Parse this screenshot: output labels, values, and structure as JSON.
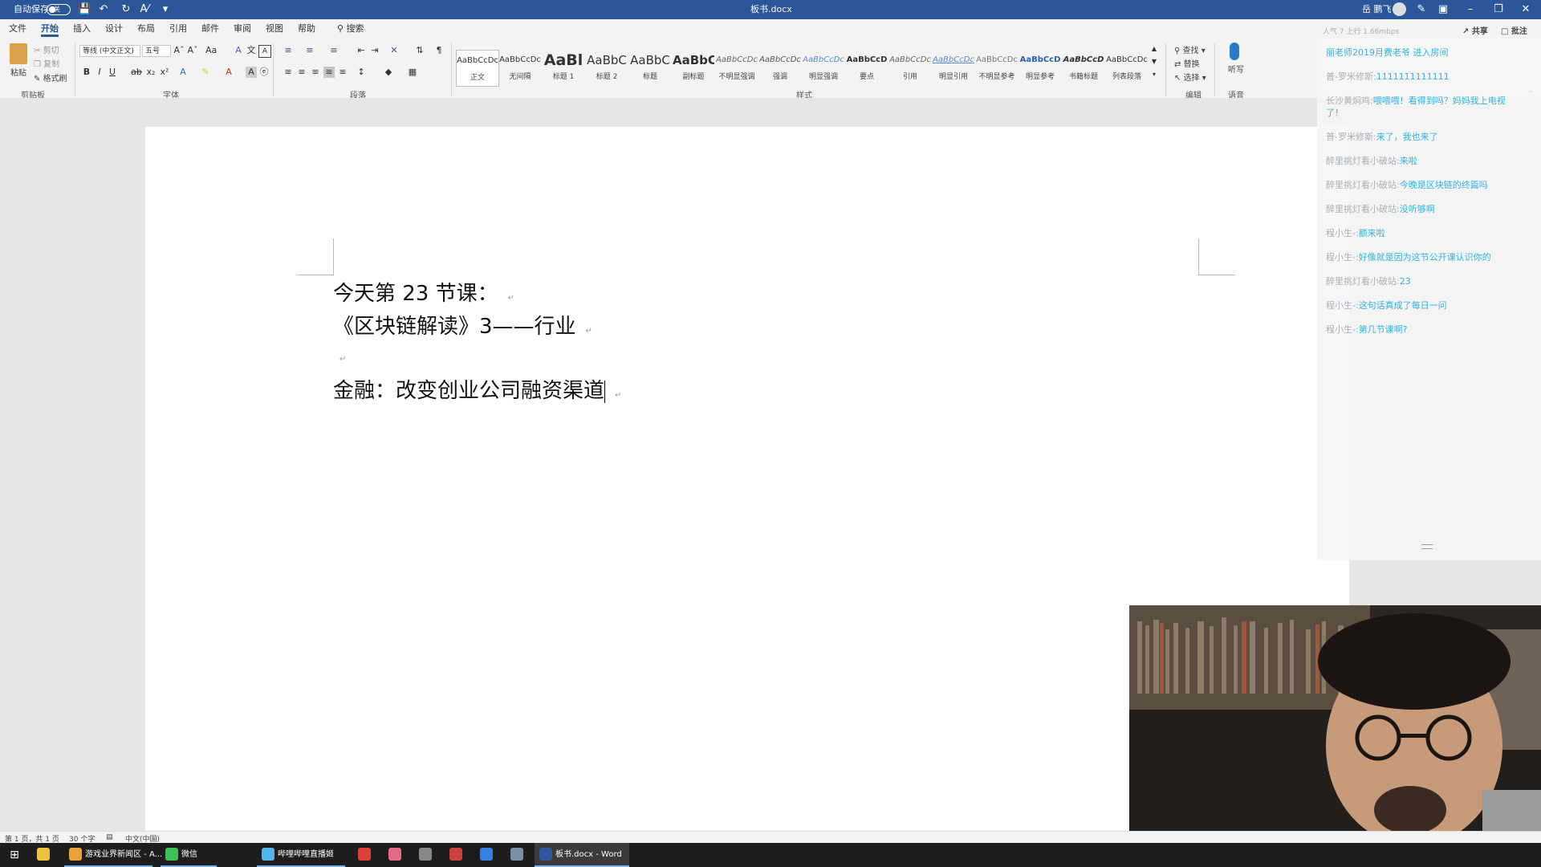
{
  "titlebar": {
    "autosave_label": "自动保存",
    "autosave_state": "关",
    "doc_title": "板书.docx",
    "user_name": "岳 鹏飞"
  },
  "menu_tabs": [
    "文件",
    "开始",
    "插入",
    "设计",
    "布局",
    "引用",
    "邮件",
    "审阅",
    "视图",
    "帮助"
  ],
  "search": {
    "label": "搜索"
  },
  "ribbon": {
    "clipboard": {
      "paste": "粘贴",
      "cut": "剪切",
      "copy": "复制",
      "format_painter": "格式刷",
      "group": "剪贴板"
    },
    "font": {
      "font_name": "等线 (中文正文)",
      "font_size": "五号",
      "group": "字体"
    },
    "paragraph": {
      "group": "段落"
    },
    "styles": {
      "group": "样式",
      "items": [
        {
          "preview": "AaBbCcDc",
          "name": "正文"
        },
        {
          "preview": "AaBbCcDc",
          "name": "无间隔"
        },
        {
          "preview": "AaBl",
          "name": "标题 1"
        },
        {
          "preview": "AaBbC",
          "name": "标题 2"
        },
        {
          "preview": "AaBbC",
          "name": "标题"
        },
        {
          "preview": "AaBbC",
          "name": "副标题"
        },
        {
          "preview": "AaBbCcDc",
          "name": "不明显强调"
        },
        {
          "preview": "AaBbCcDc",
          "name": "强调"
        },
        {
          "preview": "AaBbCcDc",
          "name": "明显强调"
        },
        {
          "preview": "AaBbCcD",
          "name": "要点"
        },
        {
          "preview": "AaBbCcDc",
          "name": "引用"
        },
        {
          "preview": "AaBbCcDc",
          "name": "明显引用"
        },
        {
          "preview": "AaBbCcDc",
          "name": "不明显参考"
        },
        {
          "preview": "AaBbCcD",
          "name": "明显参考"
        },
        {
          "preview": "AaBbCcD",
          "name": "书籍标题"
        },
        {
          "preview": "AaBbCcDc",
          "name": "列表段落"
        }
      ]
    },
    "editing": {
      "find": "查找",
      "replace": "替换",
      "select": "选择",
      "group": "编辑"
    },
    "voice": {
      "dictate": "听写",
      "group": "语音"
    },
    "share": "共享",
    "comments": "批注"
  },
  "document": {
    "lines": [
      "今天第 23 节课：",
      "《区块链解读》3——行业",
      "",
      "金融：改变创业公司融资渠道"
    ]
  },
  "chat": {
    "header": "人气 7   上行 1.66mbps",
    "messages": [
      {
        "user": "",
        "text": "丽老师2019月费老爷 进入房间"
      },
      {
        "user": "普-罗米修斯:",
        "text": "1111111111111"
      },
      {
        "user": "长沙黄焖鸡:",
        "text": "喂喂喂！看得到吗？妈妈我上电视了！"
      },
      {
        "user": "普-罗米修斯:",
        "text": "来了，我也来了"
      },
      {
        "user": "醉里挑灯看小破站:",
        "text": "来啦"
      },
      {
        "user": "醉里挑灯看小破站:",
        "text": "今晚是区块链的终篇吗"
      },
      {
        "user": "醉里挑灯看小破站:",
        "text": "没听够啊"
      },
      {
        "user": "程小生-:",
        "text": "额来啦"
      },
      {
        "user": "程小生-:",
        "text": "好像就是因为这节公开课认识你的"
      },
      {
        "user": "醉里挑灯看小破站:",
        "text": "23"
      },
      {
        "user": "程小生-:",
        "text": "这句话真成了每日一问"
      },
      {
        "user": "程小生-:",
        "text": "第几节课啊?"
      }
    ]
  },
  "statusbar": {
    "page": "第 1 页，共 1 页",
    "words": "30 个字",
    "lang": "中文(中国)"
  },
  "taskbar": {
    "items": [
      {
        "label": "游戏业界新闻区 - A...",
        "color": "#e8a33d"
      },
      {
        "label": "微信",
        "color": "#3dbf5a"
      },
      {
        "label": "哔哩哔哩直播姬",
        "color": "#55b5e6"
      },
      {
        "label": "",
        "color": "#e0403a"
      },
      {
        "label": "",
        "color": "#e86a8a"
      },
      {
        "label": "",
        "color": "#888888"
      },
      {
        "label": "",
        "color": "#c9423a"
      },
      {
        "label": "",
        "color": "#3a7ee0"
      },
      {
        "label": "",
        "color": "#7a8fa3"
      },
      {
        "label": "板书.docx - Word",
        "color": "#2b579a"
      }
    ]
  }
}
